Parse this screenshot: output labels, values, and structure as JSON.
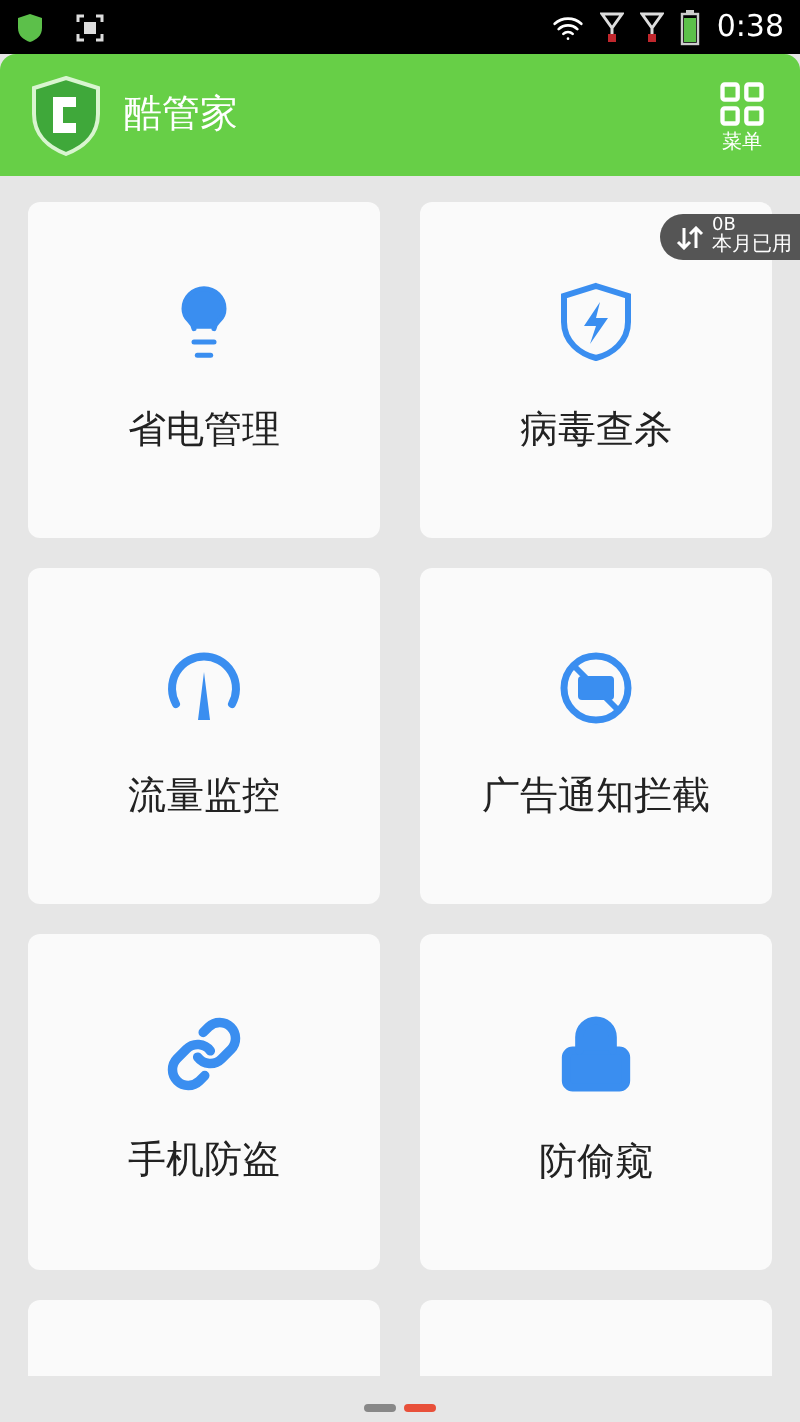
{
  "status_bar": {
    "time": "0:38"
  },
  "header": {
    "title": "酷管家",
    "menu_label": "菜单"
  },
  "traffic_badge": {
    "value": "0B",
    "label": "本月已用"
  },
  "tiles": [
    {
      "kind": "bulb",
      "label": "省电管理"
    },
    {
      "kind": "shield",
      "label": "病毒查杀"
    },
    {
      "kind": "gauge",
      "label": "流量监控"
    },
    {
      "kind": "ad",
      "label": "广告通知拦截"
    },
    {
      "kind": "link",
      "label": "手机防盗"
    },
    {
      "kind": "lock",
      "label": "防偷窥"
    },
    {
      "kind": "cut"
    },
    {
      "kind": "cut"
    }
  ],
  "pager": [
    {
      "selected": false
    },
    {
      "selected": true
    }
  ]
}
